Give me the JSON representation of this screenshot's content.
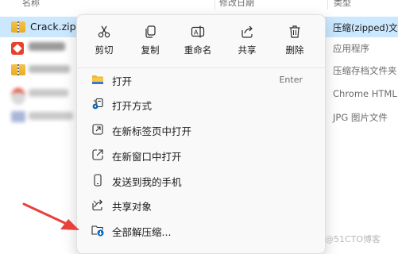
{
  "header": {
    "name": "名称",
    "date": "修改日期",
    "type": "类型"
  },
  "files": [
    {
      "name": "Crack.zip",
      "type": "压缩(zipped)文",
      "selected": true
    },
    {
      "name": "...ond-...",
      "type": "应用程序"
    },
    {
      "name": "",
      "type": "压缩存档文件夹"
    },
    {
      "name": "",
      "type": "Chrome HTML"
    },
    {
      "name": "",
      "type": "JPG 图片文件"
    }
  ],
  "toolbar": [
    {
      "label": "剪切",
      "icon": "scissors-icon"
    },
    {
      "label": "复制",
      "icon": "copy-icon"
    },
    {
      "label": "重命名",
      "icon": "rename-icon"
    },
    {
      "label": "共享",
      "icon": "share-icon"
    },
    {
      "label": "删除",
      "icon": "trash-icon"
    }
  ],
  "menu": [
    {
      "label": "打开",
      "shortcut": "Enter",
      "icon": "zip-folder-icon"
    },
    {
      "label": "打开方式",
      "icon": "open-with-icon",
      "submenu": true
    },
    {
      "label": "在新标签页中打开",
      "icon": "new-tab-icon"
    },
    {
      "label": "在新窗口中打开",
      "icon": "new-window-icon"
    },
    {
      "label": "发送到我的手机",
      "icon": "phone-icon"
    },
    {
      "label": "共享对象",
      "icon": "share-icon",
      "submenu": true
    },
    {
      "label": "全部解压缩...",
      "icon": "extract-icon"
    }
  ],
  "watermark": "@51CTO博客",
  "colors": {
    "selection": "#cce8ff",
    "accent": "#0067c0",
    "arrow": "#e8413c"
  }
}
